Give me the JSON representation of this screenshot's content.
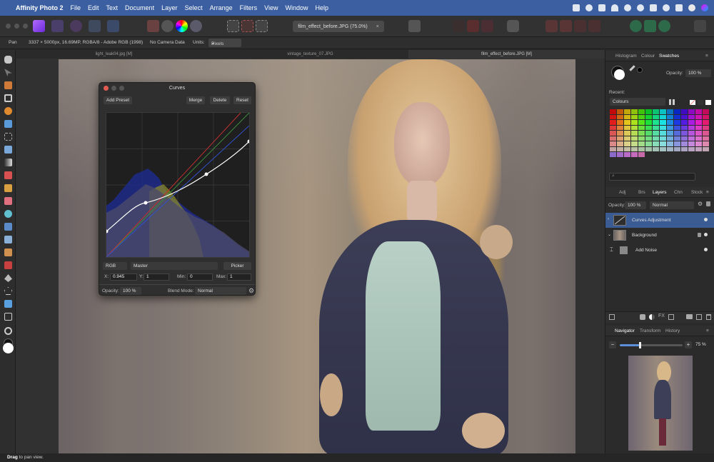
{
  "menubar": {
    "app_name": "Affinity Photo 2",
    "items": [
      "File",
      "Edit",
      "Text",
      "Document",
      "Layer",
      "Select",
      "Arrange",
      "Filters",
      "View",
      "Window",
      "Help"
    ]
  },
  "toolbar": {
    "document_title": "film_effect_before.JPG (75.0%)"
  },
  "context_bar": {
    "tool": "Pan",
    "image_info": "3337 × 5000px, 16.69MP, RGBA/8 - Adobe RGB (1998)",
    "camera": "No Camera Data",
    "units_label": "Units:",
    "units_value": "Pixels"
  },
  "document_tabs": [
    "light_leak04.jpg [M]",
    "vintage_texture_07.JPG",
    "film_effect_before.JPG [M]"
  ],
  "curves": {
    "title": "Curves",
    "add_preset": "Add Preset",
    "merge": "Merge",
    "delete": "Delete",
    "reset": "Reset",
    "channel_space": "RGB",
    "channel": "Master",
    "picker": "Picker",
    "x_label": "X:",
    "x_value": "0.945",
    "y_label": "Y:",
    "y_value": "1",
    "min_label": "Min:",
    "min_value": "0",
    "max_label": "Max:",
    "max_value": "1",
    "opacity_label": "Opacity:",
    "opacity_value": "100 %",
    "blend_label": "Blend Mode:",
    "blend_value": "Normal"
  },
  "swatches_panel": {
    "tabs": [
      "Histogram",
      "Colour",
      "Swatches"
    ],
    "active_tab": "Swatches",
    "opacity_label": "Opacity:",
    "opacity_value": "100 %",
    "recent_label": "Recent:",
    "palette": "Colours"
  },
  "layers_panel": {
    "tabs": [
      "Adj",
      "Brs",
      "Layers",
      "Chn",
      "Stock"
    ],
    "active_tab": "Layers",
    "opacity_label": "Opacity:",
    "opacity_value": "100 %",
    "blend_value": "Normal",
    "layers": [
      {
        "name": "Curves Adjustment",
        "selected": true
      },
      {
        "name": "Background",
        "selected": false
      },
      {
        "name": "Add Noise",
        "selected": false
      }
    ]
  },
  "navigator_panel": {
    "tabs": [
      "Navigator",
      "Transform",
      "History"
    ],
    "active_tab": "Navigator",
    "zoom_value": "75 %",
    "zoom_fraction": 0.32
  },
  "status": {
    "bold": "Drag",
    "text": "to pan view."
  }
}
